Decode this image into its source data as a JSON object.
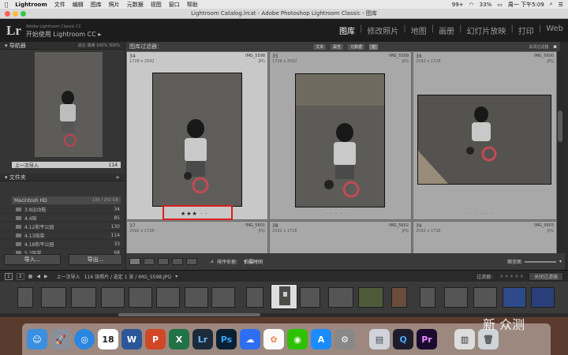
{
  "menubar": {
    "app": "Lightroom",
    "items": [
      "文件",
      "编辑",
      "图库",
      "照片",
      "元数据",
      "视图",
      "窗口",
      "帮助"
    ],
    "status": {
      "percent": "99+",
      "battery": "33%",
      "clock": "周一 下午5:09"
    }
  },
  "window": {
    "title": "Lightroom Catalog.lrcat - Adobe Photoshop Lightroom Classic - 图库"
  },
  "header": {
    "logo": "Lr",
    "subtitle": "Adobe Lightroom Classic CC",
    "title": "开始使用 Lightroom CC ▸",
    "modules": [
      "图库",
      "修改照片",
      "地图",
      "画册",
      "幻灯片放映",
      "打印",
      "Web"
    ],
    "active_module": "图库"
  },
  "left": {
    "navigator": "导航器",
    "nav_opts": "适合 填满 100% 300%",
    "previous_import": "上一次导入",
    "previous_import_count": "114",
    "folders_label": "文件夹",
    "drive": {
      "name": "Macintosh HD",
      "usage": "185 / 251 GB"
    },
    "folders": [
      {
        "name": "3.8运动鞋",
        "count": "34"
      },
      {
        "name": "4.4陪",
        "count": "85"
      },
      {
        "name": "4.12和平公园",
        "count": "130"
      },
      {
        "name": "4.13陪菜",
        "count": "114"
      },
      {
        "name": "4.18和平公园",
        "count": "33"
      },
      {
        "name": "5.2陪菜",
        "count": "68"
      }
    ],
    "import_button": "导入...",
    "export_button": "导出..."
  },
  "filterbar": {
    "label": "图库过滤器：",
    "chips": [
      "文本",
      "属性",
      "元数据",
      "无"
    ],
    "right": "关闭过滤器"
  },
  "grid": {
    "cells": [
      {
        "num": "34",
        "dim": "1728 x 2592",
        "name": "IMG_5598",
        "ext": "JPG",
        "rating": "★★★ · ·"
      },
      {
        "num": "35",
        "dim": "1728 x 2592",
        "name": "IMG_5599",
        "ext": "JPG",
        "rating": "· · · · ·"
      },
      {
        "num": "36",
        "dim": "2592 x 1728",
        "name": "IMG_5600",
        "ext": "JPG",
        "rating": "· · · · ·"
      },
      {
        "num": "37",
        "dim": "2592 x 1728",
        "name": "IMG_5601",
        "ext": "JPG"
      },
      {
        "num": "38",
        "dim": "2592 x 1728",
        "name": "IMG_5602",
        "ext": "JPG"
      },
      {
        "num": "39",
        "dim": "2592 x 1728",
        "name": "IMG_5603",
        "ext": "JPG"
      }
    ]
  },
  "toolbar": {
    "sort_label": "排序依据：",
    "sort_value": "拍摄时间",
    "thumbs_label": "缩览图"
  },
  "filmhead": {
    "pages": [
      "1",
      "2"
    ],
    "source": "上一次导入",
    "summary": "114 张照片 / 选定 1 张 / IMG_5598.JPG",
    "filter_label": "过滤器：",
    "filter_value": "关闭过滤器"
  },
  "dock": {
    "calendar_day": "18",
    "icons": [
      "finder-icon",
      "launchpad-icon",
      "safari-icon",
      "calendar-icon",
      "word-icon",
      "powerpoint-icon",
      "excel-icon",
      "lightroom-icon",
      "photoshop-icon",
      "baidu-icon",
      "photos-icon",
      "wechat-icon",
      "appstore-icon",
      "settings-icon",
      "preview-icon",
      "quicktime-icon",
      "premiere-icon",
      "trash-icon"
    ],
    "lr": "Lr",
    "ps": "Ps",
    "pr": "Pr",
    "w": "W",
    "p": "P",
    "x": "X"
  },
  "watermark": "新 众测",
  "colors": {
    "accent_red": "#d8201f",
    "panel": "#353535",
    "grid_bg": "#808080"
  }
}
